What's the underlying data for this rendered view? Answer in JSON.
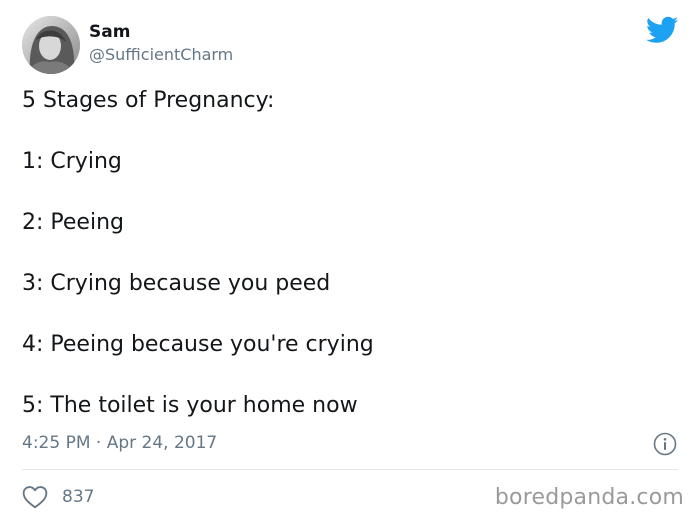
{
  "author": {
    "display_name": "Sam",
    "handle": "@SufficientCharm",
    "avatar_icon": "user-avatar-photo"
  },
  "brand": {
    "logo_icon": "twitter-bird-icon",
    "color": "#1da1f2"
  },
  "tweet": {
    "lines": [
      "5 Stages of Pregnancy:",
      "1: Crying",
      "2: Peeing",
      "3: Crying because you peed",
      "4: Peeing because you're crying",
      "5: The toilet is your home now"
    ]
  },
  "meta": {
    "timestamp": "4:25 PM · Apr 24, 2017",
    "info_icon": "info-icon"
  },
  "actions": {
    "like_icon": "heart-icon",
    "like_count": "837"
  },
  "watermark": "boredpanda.com",
  "colors": {
    "text_primary": "#14171a",
    "text_secondary": "#657786",
    "divider": "#e1e8ed"
  }
}
